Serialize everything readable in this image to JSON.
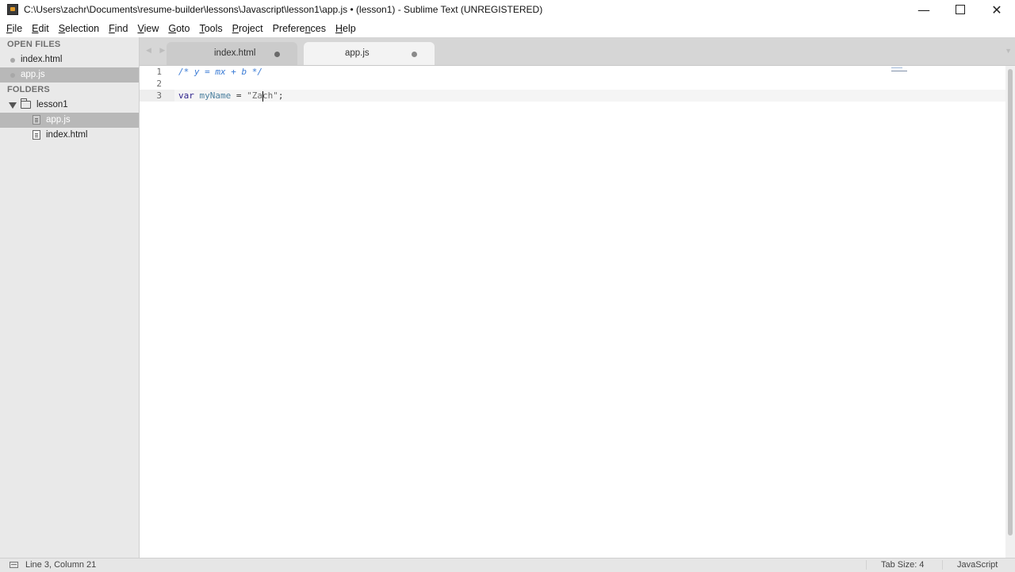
{
  "window": {
    "title": "C:\\Users\\zachr\\Documents\\resume-builder\\lessons\\Javascript\\lesson1\\app.js • (lesson1) - Sublime Text (UNREGISTERED)",
    "controls": {
      "minimize": "—",
      "close": "✕"
    }
  },
  "menu": [
    {
      "label": "File",
      "accel": "F",
      "rest": "ile"
    },
    {
      "label": "Edit",
      "accel": "E",
      "rest": "dit"
    },
    {
      "label": "Selection",
      "accel": "S",
      "rest": "election"
    },
    {
      "label": "Find",
      "accel": "F",
      "rest": "ind"
    },
    {
      "label": "View",
      "accel": "V",
      "rest": "iew"
    },
    {
      "label": "Goto",
      "accel": "G",
      "rest": "oto"
    },
    {
      "label": "Tools",
      "accel": "T",
      "rest": "ools"
    },
    {
      "label": "Project",
      "accel": "P",
      "rest": "roject"
    },
    {
      "label": "Preferences",
      "accel": "n",
      "pre": "Prefere",
      "rest": "ces"
    },
    {
      "label": "Help",
      "accel": "H",
      "rest": "elp"
    }
  ],
  "sidebar": {
    "open_files_header": "OPEN FILES",
    "open_files": [
      {
        "name": "index.html",
        "selected": false
      },
      {
        "name": "app.js",
        "selected": true
      }
    ],
    "folders_header": "FOLDERS",
    "folder": {
      "name": "lesson1",
      "files": [
        {
          "name": "app.js",
          "selected": true
        },
        {
          "name": "index.html",
          "selected": false
        }
      ]
    }
  },
  "tabs": {
    "nav": "◀ ▶",
    "items": [
      {
        "label": "index.html",
        "active": false
      },
      {
        "label": "app.js",
        "active": true
      }
    ],
    "dropdown": "▼"
  },
  "editor": {
    "line_numbers": [
      "1",
      "2",
      "3"
    ],
    "current_line": 3,
    "lines": {
      "l1_comment": "/* y = mx + b */",
      "l3_keyword": "var",
      "l3_space1": " ",
      "l3_name": "myName",
      "l3_op": " = ",
      "l3_str_before_cursor": "\"Za",
      "l3_str_after_cursor": "ch\"",
      "l3_end": ";"
    }
  },
  "status": {
    "position": "Line 3, Column 21",
    "tab_size": "Tab Size: 4",
    "syntax": "JavaScript"
  },
  "colors": {
    "comment": "#3a7bd5",
    "keyword": "#2b1f8a",
    "variable": "#4a7f9e",
    "sidebar_bg": "#e9e9e9",
    "tabbar_bg": "#d6d6d6"
  }
}
